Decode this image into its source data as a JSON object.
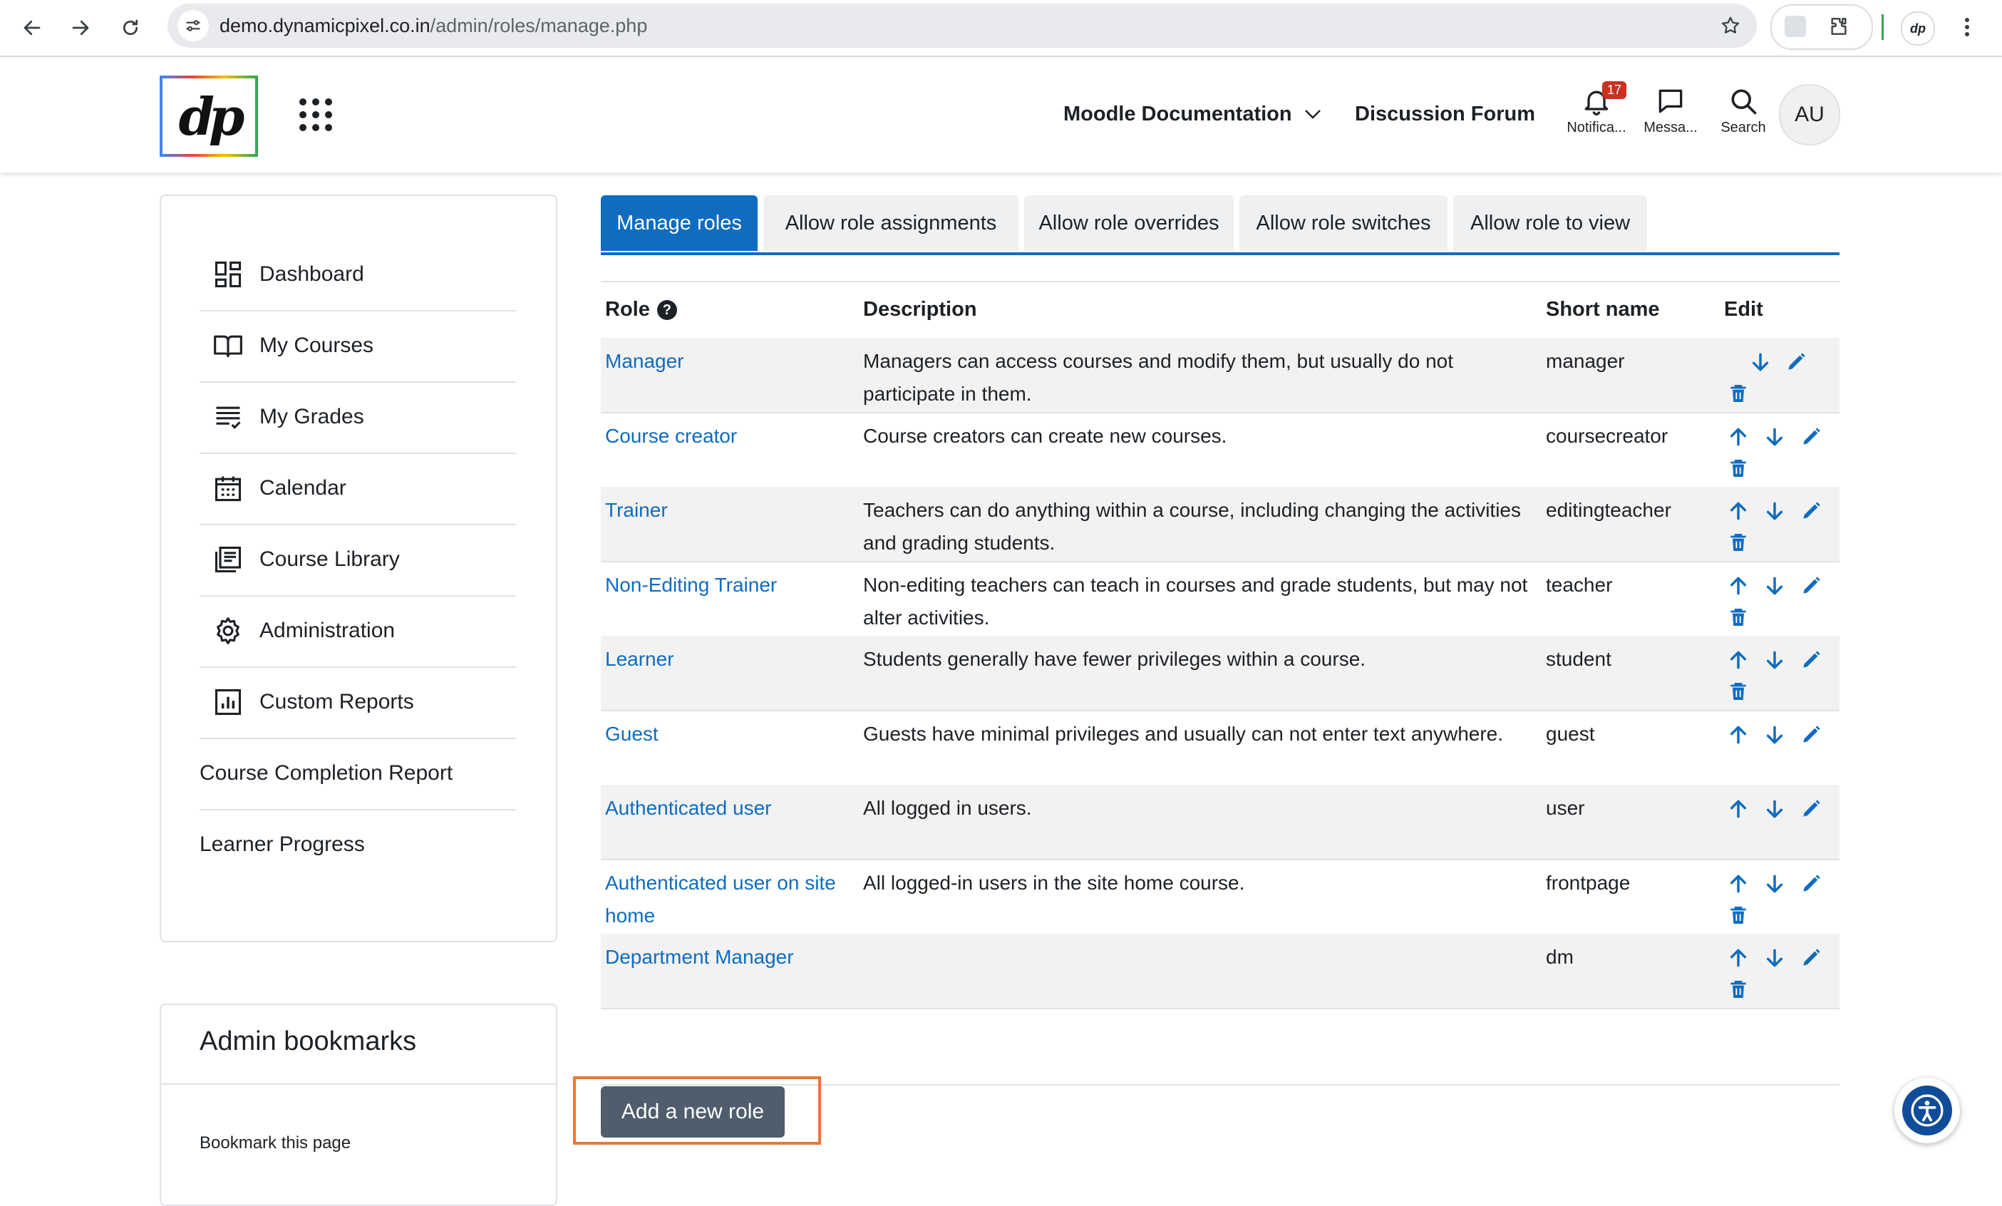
{
  "browser": {
    "url_host": "demo.dynamicpixel.co.in",
    "url_path": "/admin/roles/manage.php",
    "profile_initials": "dp"
  },
  "header": {
    "logo_text": "dp",
    "nav": [
      {
        "label": "Moodle Documentation"
      },
      {
        "label": "Discussion Forum"
      }
    ],
    "icons": {
      "notifications": {
        "caption": "Notifica...",
        "badge": "17"
      },
      "messages": {
        "caption": "Messa..."
      },
      "search": {
        "caption": "Search"
      }
    },
    "avatar": "AU"
  },
  "sidebar": {
    "items": [
      {
        "label": "Dashboard",
        "icon": "dashboard-icon"
      },
      {
        "label": "My Courses",
        "icon": "open-book-icon"
      },
      {
        "label": "My Grades",
        "icon": "grades-list-icon"
      },
      {
        "label": "Calendar",
        "icon": "calendar-icon"
      },
      {
        "label": "Course Library",
        "icon": "library-icon"
      },
      {
        "label": "Administration",
        "icon": "gear-icon"
      },
      {
        "label": "Custom Reports",
        "icon": "report-chart-icon"
      },
      {
        "label": "Course Completion Report",
        "icon": ""
      },
      {
        "label": "Learner Progress",
        "icon": ""
      }
    ]
  },
  "bookmarks": {
    "title": "Admin bookmarks",
    "link": "Bookmark this page"
  },
  "tabs": [
    {
      "label": "Manage roles",
      "active": true
    },
    {
      "label": "Allow role assignments",
      "active": false
    },
    {
      "label": "Allow role overrides",
      "active": false
    },
    {
      "label": "Allow role switches",
      "active": false
    },
    {
      "label": "Allow role to view",
      "active": false
    }
  ],
  "table": {
    "headers": {
      "role": "Role",
      "description": "Description",
      "short_name": "Short name",
      "edit": "Edit"
    },
    "rows": [
      {
        "role": "Manager",
        "description": "Managers can access courses and modify them, but usually do not participate in them.",
        "short_name": "manager",
        "actions": [
          "down",
          "edit",
          "delete"
        ]
      },
      {
        "role": "Course creator",
        "description": "Course creators can create new courses.",
        "short_name": "coursecreator",
        "actions": [
          "up",
          "down",
          "edit",
          "delete"
        ]
      },
      {
        "role": "Trainer",
        "description": "Teachers can do anything within a course, including changing the activities and grading students.",
        "short_name": "editingteacher",
        "actions": [
          "up",
          "down",
          "edit",
          "delete"
        ]
      },
      {
        "role": "Non-Editing Trainer",
        "description": "Non-editing teachers can teach in courses and grade students, but may not alter activities.",
        "short_name": "teacher",
        "actions": [
          "up",
          "down",
          "edit",
          "delete"
        ]
      },
      {
        "role": "Learner",
        "description": "Students generally have fewer privileges within a course.",
        "short_name": "student",
        "actions": [
          "up",
          "down",
          "edit",
          "delete"
        ]
      },
      {
        "role": "Guest",
        "description": "Guests have minimal privileges and usually can not enter text anywhere.",
        "short_name": "guest",
        "actions": [
          "up",
          "down",
          "edit"
        ]
      },
      {
        "role": "Authenticated user",
        "description": "All logged in users.",
        "short_name": "user",
        "actions": [
          "up",
          "down",
          "edit"
        ]
      },
      {
        "role": "Authenticated user on site home",
        "description": "All logged-in users in the site home course.",
        "short_name": "frontpage",
        "actions": [
          "up",
          "down",
          "edit",
          "delete"
        ]
      },
      {
        "role": "Department Manager",
        "description": "",
        "short_name": "dm",
        "actions": [
          "up",
          "down",
          "edit",
          "delete"
        ]
      }
    ]
  },
  "add_button_label": "Add a new role",
  "colors": {
    "primary": "#0f6cbf",
    "button_secondary": "#4f5d6d",
    "highlight_border": "#e97931",
    "notification_badge": "#ca3120"
  }
}
